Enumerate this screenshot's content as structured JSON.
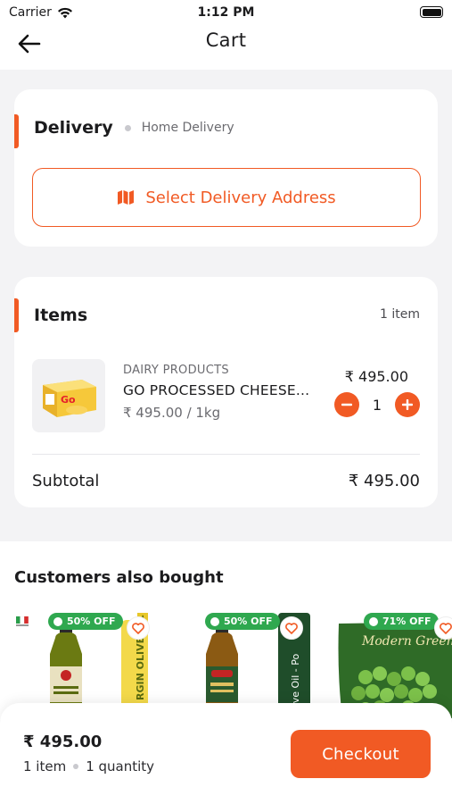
{
  "status_bar": {
    "carrier": "Carrier",
    "time": "1:12 PM"
  },
  "nav": {
    "title": "Cart",
    "back_icon": "arrow-left-icon"
  },
  "delivery": {
    "heading": "Delivery",
    "mode": "Home Delivery",
    "address_button": "Select Delivery Address",
    "address_icon": "map-icon"
  },
  "items": {
    "heading": "Items",
    "count_label": "1 item",
    "list": [
      {
        "category": "DAIRY PRODUCTS",
        "name": "GO PROCESSED CHEESE...",
        "unit_price": "₹ 495.00 / 1kg",
        "line_price": "₹ 495.00",
        "quantity": "1"
      }
    ],
    "subtotal_label": "Subtotal",
    "subtotal_value": "₹ 495.00"
  },
  "recommendations": {
    "title": "Customers also bought",
    "products": [
      {
        "discount": "50% OFF",
        "label_text": "RGIN OLIVE OIL",
        "bottle_color": "#6b7a12"
      },
      {
        "discount": "50% OFF",
        "label_text": "Olive Oil - Po",
        "bottle_color": "#5a6b10"
      },
      {
        "discount": "71% OFF",
        "label_text": "Modern Green Peas",
        "bottle_color": "#3c7d2a"
      }
    ]
  },
  "footer": {
    "total": "₹ 495.00",
    "items_label": "1 item",
    "quantity_label": "1 quantity",
    "checkout_label": "Checkout"
  },
  "colors": {
    "accent": "#f15a24",
    "badge_green": "#2fa84f"
  }
}
